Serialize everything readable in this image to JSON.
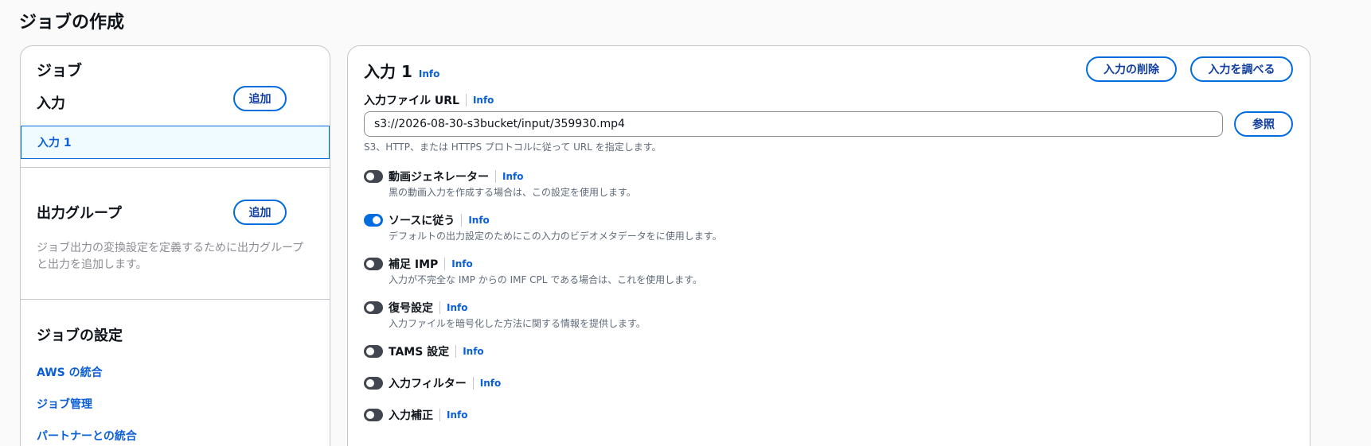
{
  "page": {
    "title": "ジョブの作成"
  },
  "nav": {
    "heading": "ジョブ",
    "input_section": {
      "title": "入力",
      "add_label": "追加",
      "selected_item": "入力 1"
    },
    "output_section": {
      "title": "出力グループ",
      "add_label": "追加",
      "description": "ジョブ出力の変換設定を定義するために出力グループと出力を追加します。"
    },
    "settings_section": {
      "title": "ジョブの設定",
      "links": [
        "AWS の統合",
        "ジョブ管理",
        "パートナーとの統合"
      ]
    }
  },
  "main": {
    "title": "入力 1",
    "info_label": "Info",
    "remove_label": "入力の削除",
    "probe_label": "入力を調べる",
    "url_field": {
      "label": "入力ファイル URL",
      "value": "s3://2026-08-30-s3bucket/input/359930.mp4",
      "browse_label": "参照",
      "hint": "S3、HTTP、または HTTPS プロトコルに従って URL を指定します。"
    },
    "toggles": [
      {
        "label": "動画ジェネレーター",
        "desc": "黒の動画入力を作成する場合は、この設定を使用します。",
        "on": false
      },
      {
        "label": "ソースに従う",
        "desc": "デフォルトの出力設定のためにこの入力のビデオメタデータをに使用します。",
        "on": true
      },
      {
        "label": "補足 IMP",
        "desc": "入力が不完全な IMP からの IMF CPL である場合は、これを使用します。",
        "on": false
      },
      {
        "label": "復号設定",
        "desc": "入力ファイルを暗号化した方法に関する情報を提供します。",
        "on": false
      },
      {
        "label": "TAMS 設定",
        "desc": "",
        "on": false
      },
      {
        "label": "入力フィルター",
        "desc": "",
        "on": false
      },
      {
        "label": "入力補正",
        "desc": "",
        "on": false
      }
    ]
  }
}
